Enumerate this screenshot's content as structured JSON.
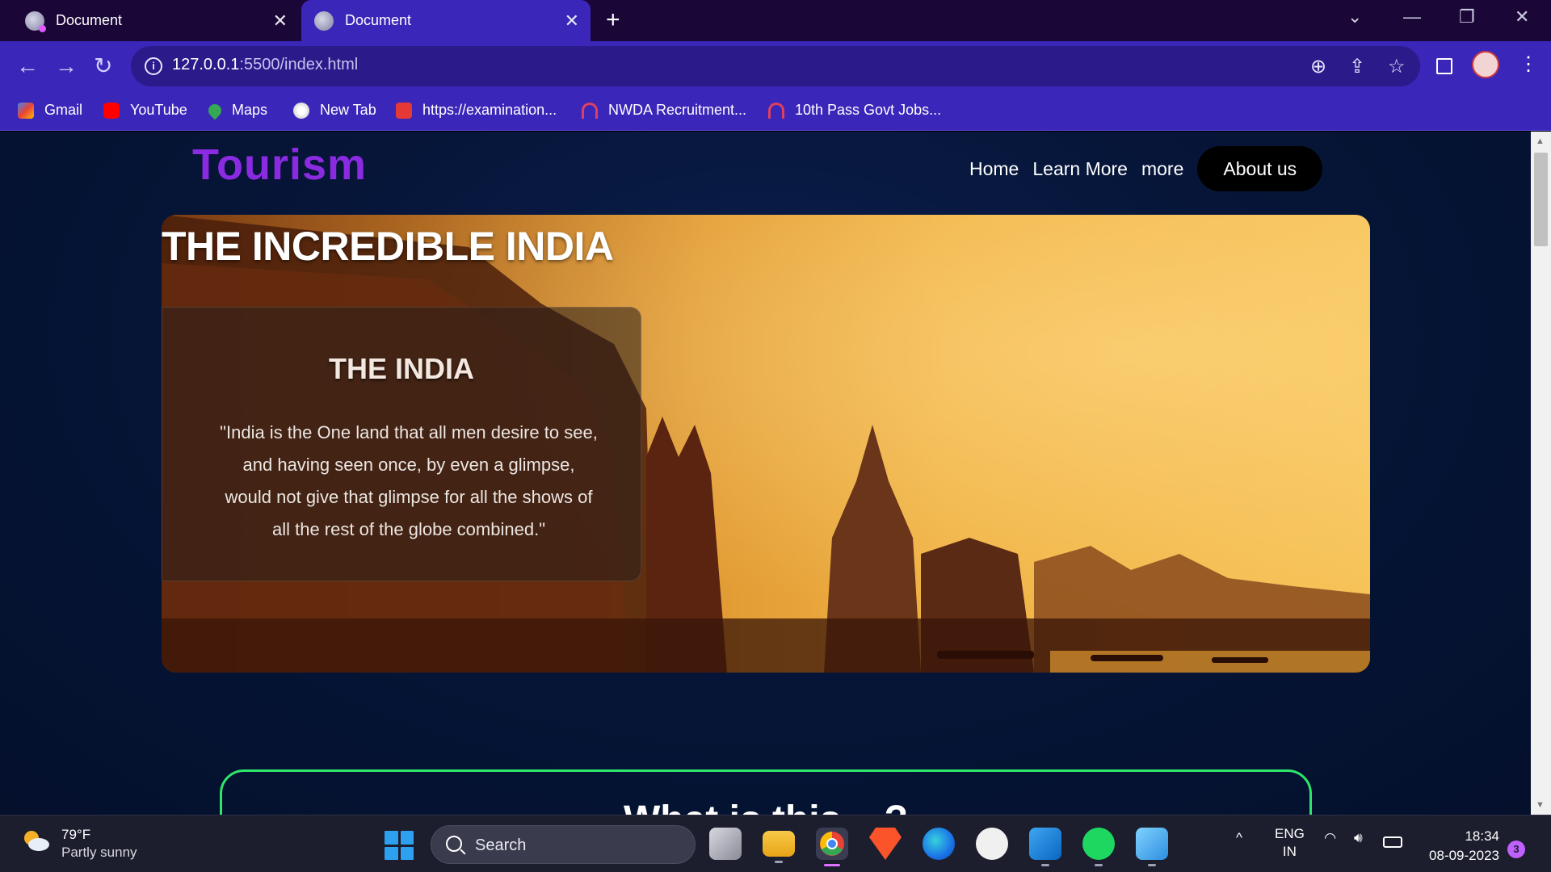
{
  "browser": {
    "tabs": [
      {
        "title": "Document",
        "close": "✕"
      },
      {
        "title": "Document",
        "close": "✕"
      }
    ],
    "new_tab": "+",
    "window_controls": {
      "dropdown": "⌄",
      "minimize": "—",
      "restore": "❐",
      "close": "✕"
    },
    "nav": {
      "back": "←",
      "forward": "→",
      "reload": "↻"
    },
    "address": {
      "host": "127.0.0.1",
      "path": ":5500/index.html",
      "info": "i"
    },
    "omni_icons": {
      "zoom": "⊕",
      "share": "⇪",
      "star": "☆"
    },
    "menu": "⋮",
    "bookmarks": [
      {
        "label": "Gmail",
        "icon": "gmail-icon",
        "color": "#ea4335"
      },
      {
        "label": "YouTube",
        "icon": "youtube-icon",
        "color": "#ff0000"
      },
      {
        "label": "Maps",
        "icon": "maps-icon",
        "color": "#34a853"
      },
      {
        "label": "New Tab",
        "icon": "globe-icon",
        "color": "#ffffff"
      },
      {
        "label": "https://examination...",
        "icon": "exam-site-icon",
        "color": "#e53935"
      },
      {
        "label": "NWDA Recruitment...",
        "icon": "nwda-icon",
        "color": "#e04060"
      },
      {
        "label": "10th Pass Govt Jobs...",
        "icon": "govt-jobs-icon",
        "color": "#e04060"
      }
    ]
  },
  "page": {
    "logo": "Tourism",
    "nav": [
      "Home",
      "Learn More",
      "more"
    ],
    "about_button": "About us",
    "hero": {
      "title": "THE INCREDIBLE INDIA",
      "card_title": "THE INDIA",
      "quote": "\"India is the One land that all men desire to see, and having seen once, by even a glimpse, would not give that glimpse for all the shows of all the rest of the globe combined.\""
    },
    "section2_heading_partial": "What is this....?"
  },
  "taskbar": {
    "weather": {
      "temp": "79°F",
      "desc": "Partly sunny"
    },
    "search_placeholder": "Search",
    "lang": {
      "line1": "ENG",
      "line2": "IN"
    },
    "tray": {
      "chevron": "^",
      "wifi": "wifi-icon",
      "volume": "speaker-icon",
      "battery": "battery-icon"
    },
    "time": "18:34",
    "date": "08-09-2023",
    "notifications": "3"
  },
  "colors": {
    "tabstrip": "#1a0637",
    "toolbar": "#3a26b8",
    "logo": "#8a2be2",
    "section_border": "#2ee66a",
    "taskbar": "#1c1e2e"
  }
}
